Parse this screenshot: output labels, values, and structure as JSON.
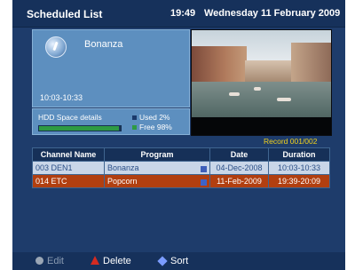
{
  "header": {
    "title": "Scheduled List",
    "time": "19:49",
    "date": "Wednesday 11 February 2009"
  },
  "program": {
    "name": "Bonanza",
    "time_range": "10:03-10:33",
    "logo_icon": "channel-logo-icon"
  },
  "hdd": {
    "label": "HDD Space details",
    "used_label": "Used 2%",
    "free_label": "Free 98%",
    "used_fraction": 0.02,
    "colors": {
      "used": "#1b3a6b",
      "free": "#2e9a44"
    }
  },
  "record_info": "Record 001/002",
  "table": {
    "headers": [
      "Channel Name",
      "Program",
      "Date",
      "Duration"
    ],
    "rows": [
      {
        "channel": "003 DEN1",
        "program": "Bonanza",
        "date": "04-Dec-2008",
        "duration": "10:03-10:33"
      },
      {
        "channel": "014 ETC",
        "program": "Popcorn",
        "date": "11-Feb-2009",
        "duration": "19:39-20:09"
      }
    ]
  },
  "footer": {
    "edit": "Edit",
    "delete": "Delete",
    "sort": "Sort"
  },
  "colors": {
    "background": "#1e3c6b",
    "selected_row": "#b13f10",
    "accent_yellow": "#f2d21d"
  }
}
